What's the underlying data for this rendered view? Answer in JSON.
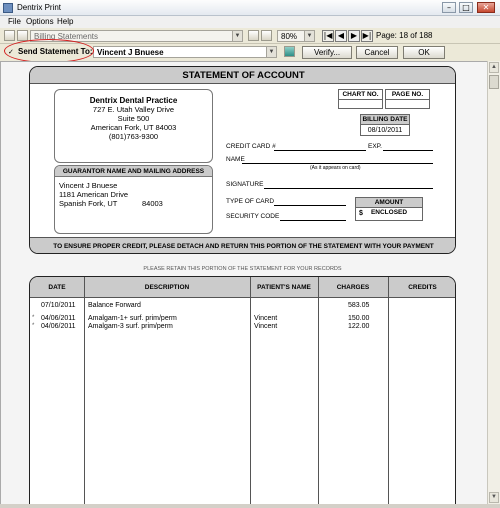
{
  "window": {
    "title": "Dentrix Print",
    "min": "–",
    "max": "□",
    "close": "✕"
  },
  "menu": [
    "File",
    "Options",
    "Help"
  ],
  "toolbar": {
    "report_select": "Billing Statements",
    "zoom": "80%",
    "page_label": "Page: 18 of 188",
    "nav_first": "|◀",
    "nav_prev": "◀",
    "nav_next": "▶",
    "nav_last": "▶|"
  },
  "toolbar2": {
    "checkbox": "✓",
    "send_label": "Send Statement To:",
    "recipient": "Vincent J Bnuese",
    "verify": "Verify...",
    "cancel": "Cancel",
    "ok": "OK"
  },
  "statement": {
    "title": "STATEMENT OF ACCOUNT",
    "practice": {
      "name": "Dentrix Dental Practice",
      "addr1": "727 E. Utah Valley Drive",
      "addr2": "Suite 500",
      "addr3": "American Fork, UT 84003",
      "phone": "(801)763-9300"
    },
    "chart_no_label": "CHART NO.",
    "page_no_label": "PAGE NO.",
    "billing_date_label": "BILLING DATE",
    "billing_date": "08/10/2011",
    "credit_card_label": "CREDIT CARD #",
    "exp_label": "EXP.",
    "name_label": "NAME",
    "as_on_card": "(As it appears on card)",
    "signature_label": "SIGNATURE",
    "type_of_card_label": "TYPE OF CARD",
    "security_code_label": "SECURITY CODE",
    "amount_enclosed_label": "AMOUNT ENCLOSED",
    "amount_symbol": "$",
    "guarantor_header": "GUARANTOR NAME AND MAILING ADDRESS",
    "guarantor": {
      "name": "Vincent J Bnuese",
      "street": "1181 American Drive",
      "city": "Spanish Fork, UT",
      "zip": "84003"
    },
    "footer": "TO ENSURE PROPER CREDIT, PLEASE DETACH AND RETURN THIS PORTION OF THE STATEMENT WITH YOUR PAYMENT"
  },
  "retain_note": "PLEASE RETAIN THIS PORTION OF THE STATEMENT FOR YOUR RECORDS",
  "account": {
    "columns": [
      "DATE",
      "DESCRIPTION",
      "PATIENT'S NAME",
      "CHARGES",
      "CREDITS"
    ],
    "rows": [
      {
        "marker": "",
        "date": "07/10/2011",
        "description": "Balance Forward",
        "patient": "",
        "charges": "583.05",
        "credits": ""
      },
      {
        "marker": "*",
        "date": "04/06/2011",
        "description": "Amalgam-1+ surf. prim/perm",
        "patient": "Vincent",
        "charges": "150.00",
        "credits": ""
      },
      {
        "marker": "*",
        "date": "04/06/2011",
        "description": "Amalgam-3 surf. prim/perm",
        "patient": "Vincent",
        "charges": "122.00",
        "credits": ""
      }
    ]
  }
}
